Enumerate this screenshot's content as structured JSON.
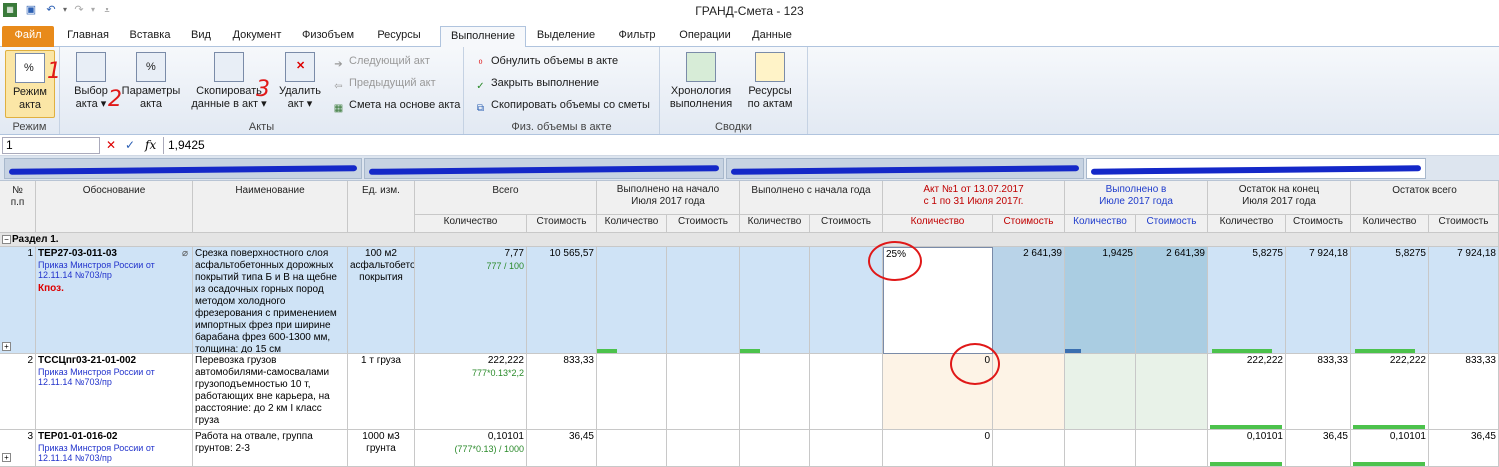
{
  "window": {
    "title": "ГРАНД-Смета - 123"
  },
  "ribbon_tabs": [
    {
      "label": "Файл"
    },
    {
      "label": "Главная"
    },
    {
      "label": "Вставка"
    },
    {
      "label": "Вид"
    },
    {
      "label": "Документ"
    },
    {
      "label": "Физобъем"
    },
    {
      "label": "Ресурсы"
    },
    {
      "label": "Выполнение"
    },
    {
      "label": "Выделение"
    },
    {
      "label": "Фильтр"
    },
    {
      "label": "Операции"
    },
    {
      "label": "Данные"
    }
  ],
  "ribbon": {
    "groups": {
      "mode": "Режим",
      "acts": "Акты",
      "phys": "Физ. объемы в акте",
      "summary": "Сводки"
    },
    "mode_btn": {
      "line1": "Режим",
      "line2": "акта"
    },
    "select_act": {
      "line1": "Выбор",
      "line2": "акта ▾"
    },
    "act_params": {
      "line1": "Параметры",
      "line2": "акта"
    },
    "copy_data": {
      "line1": "Скопировать",
      "line2": "данные в акт ▾"
    },
    "delete_act": {
      "line1": "Удалить",
      "line2": "акт ▾"
    },
    "next_act": "Следующий акт",
    "prev_act": "Предыдущий акт",
    "estimate_from_act": "Смета на основе акта",
    "zero_volumes": "Обнулить объемы в акте",
    "close_execution": "Закрыть выполнение",
    "copy_volumes": "Скопировать объемы со сметы",
    "chronology": {
      "line1": "Хронология",
      "line2": "выполнения"
    },
    "resources_by_acts": {
      "line1": "Ресурсы",
      "line2": "по актам"
    }
  },
  "formula_bar": {
    "cell": "1",
    "value": "1,9425"
  },
  "annotations": [
    "1",
    "2",
    "3"
  ],
  "columns": {
    "num": "№\nп.п",
    "basis": "Обоснование",
    "name": "Наименование",
    "unit": "Ед. изм.",
    "total": "Всего",
    "done_start": "Выполнено на начало\nИюля 2017 года",
    "done_year": "Выполнено с начала года",
    "act": "Акт №1 от 13.07.2017\nс 1 по 31 Июля 2017г.",
    "done_in": "Выполнено в\nИюле 2017 года",
    "rest_end": "Остаток на конец\nИюля 2017 года",
    "rest_all": "Остаток всего",
    "qty": "Количество",
    "cost": "Стоимость"
  },
  "section": "Раздел 1.",
  "rows": [
    {
      "n": "1",
      "code": "ТЕР27-03-011-03",
      "order": "Приказ Минстроя России от 12.11.14 №703/пр",
      "kpoz": "Кпоз.",
      "name": "Срезка поверхностного слоя асфальтобетонных дорожных покрытий типа Б и В на щебне из осадочных горных пород методом холодного фрезерования с применением импортных фрез при ширине барабана фрез 600-1300 мм, толщина: до 15 см",
      "unit": "100 м2 асфальтобетонного покрытия",
      "total_qty": "7,77",
      "total_sub": "777 / 100",
      "total_cost": "10 565,57",
      "act_qty": "25%",
      "act_cost": "2 641,39",
      "done_qty": "1,9425",
      "done_cost": "2 641,39",
      "rest_end_qty": "5,8275",
      "rest_end_cost": "7 924,18",
      "rest_all_qty": "5,8275",
      "rest_all_cost": "7 924,18"
    },
    {
      "n": "2",
      "code": "ТССЦпг03-21-01-002",
      "order": "Приказ Минстроя России от 12.11.14 №703/пр",
      "name": "Перевозка грузов автомобилями-самосвалами грузоподъемностью 10 т, работающих вне карьера, на расстояние: до 2 км I класс груза",
      "unit": "1 т груза",
      "total_qty": "222,222",
      "total_sub": "777*0.13*2,2",
      "total_cost": "833,33",
      "act_qty": "0",
      "rest_end_qty": "222,222",
      "rest_end_cost": "833,33",
      "rest_all_qty": "222,222",
      "rest_all_cost": "833,33"
    },
    {
      "n": "3",
      "code": "ТЕР01-01-016-02",
      "order": "Приказ Минстроя России от 12.11.14 №703/пр",
      "name": "Работа на отвале, группа грунтов: 2-3",
      "unit": "1000 м3 грунта",
      "total_qty": "0,10101",
      "total_sub": "(777*0.13) / 1000",
      "total_cost": "36,45",
      "act_qty": "0",
      "rest_end_qty": "0,10101",
      "rest_end_cost": "36,45",
      "rest_all_qty": "0,10101",
      "rest_all_cost": "36,45"
    }
  ]
}
